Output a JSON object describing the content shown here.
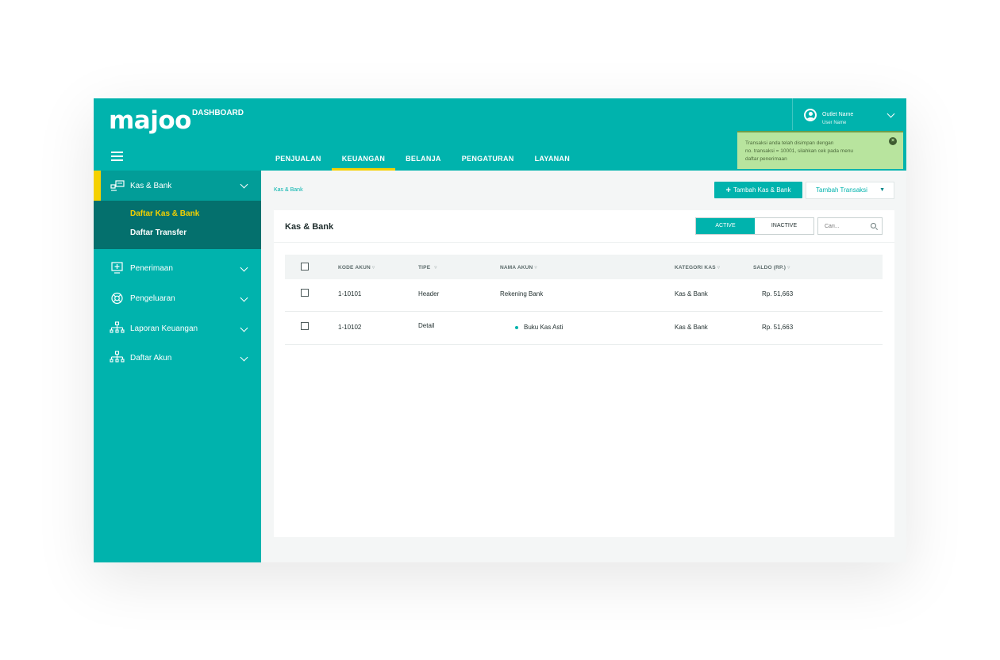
{
  "brand": {
    "logo": "majoo",
    "subtitle": "DASHBOARD"
  },
  "nav": {
    "tabs": [
      "PENJUALAN",
      "KEUANGAN",
      "BELANJA",
      "PENGATURAN",
      "LAYANAN"
    ],
    "active_index": 1
  },
  "outlet": {
    "name": "Outlet Name",
    "user": "User Name"
  },
  "toast": {
    "line1": "Transaksi anda telah disimpan dengan",
    "line2": "no. transaksi = 10001, silahkan cek pada menu",
    "line3": "daftar penerimaan",
    "close_glyph": "×"
  },
  "sidebar": {
    "section": {
      "label": "Kas & Bank"
    },
    "subitems": [
      {
        "label": "Daftar Kas & Bank",
        "active": true
      },
      {
        "label": "Daftar Transfer",
        "active": false
      }
    ],
    "items": [
      {
        "label": "Penerimaan",
        "icon": "receipt-icon"
      },
      {
        "label": "Pengeluaran",
        "icon": "lifebuoy-icon"
      },
      {
        "label": "Laporan Keuangan",
        "icon": "hierarchy-icon"
      },
      {
        "label": "Daftar Akun",
        "icon": "hierarchy-icon"
      }
    ]
  },
  "breadcrumb": "Kas & Bank",
  "actions": {
    "primary": "Tambah Kas & Bank",
    "secondary": "Tambah Transaksi",
    "caret": "▼",
    "plus": "+"
  },
  "card": {
    "title": "Kas & Bank",
    "toggle": {
      "active": "ACTIVE",
      "inactive": "INACTIVE"
    },
    "search_placeholder": "Cari..."
  },
  "table": {
    "columns": [
      "KODE AKUN",
      "TIPE",
      "NAMA AKUN",
      "KATEGORI KAS",
      "SALDO (RP.)"
    ],
    "sort_glyph": "▿",
    "rows": [
      {
        "kode": "1-10101",
        "tipe": "Header",
        "nama": "Rekening Bank",
        "kategori": "Kas & Bank",
        "saldo": "Rp. 51,663"
      },
      {
        "kode": "1-10102",
        "tipe": "Detail",
        "nama": "Buku Kas Asti",
        "kategori": "Kas & Bank",
        "saldo": "Rp. 51,663"
      }
    ]
  },
  "colors": {
    "primary": "#00b3ad",
    "sidebar_dark": "#04706d",
    "accent": "#f5d100",
    "toast_bg": "#b8e49e"
  }
}
